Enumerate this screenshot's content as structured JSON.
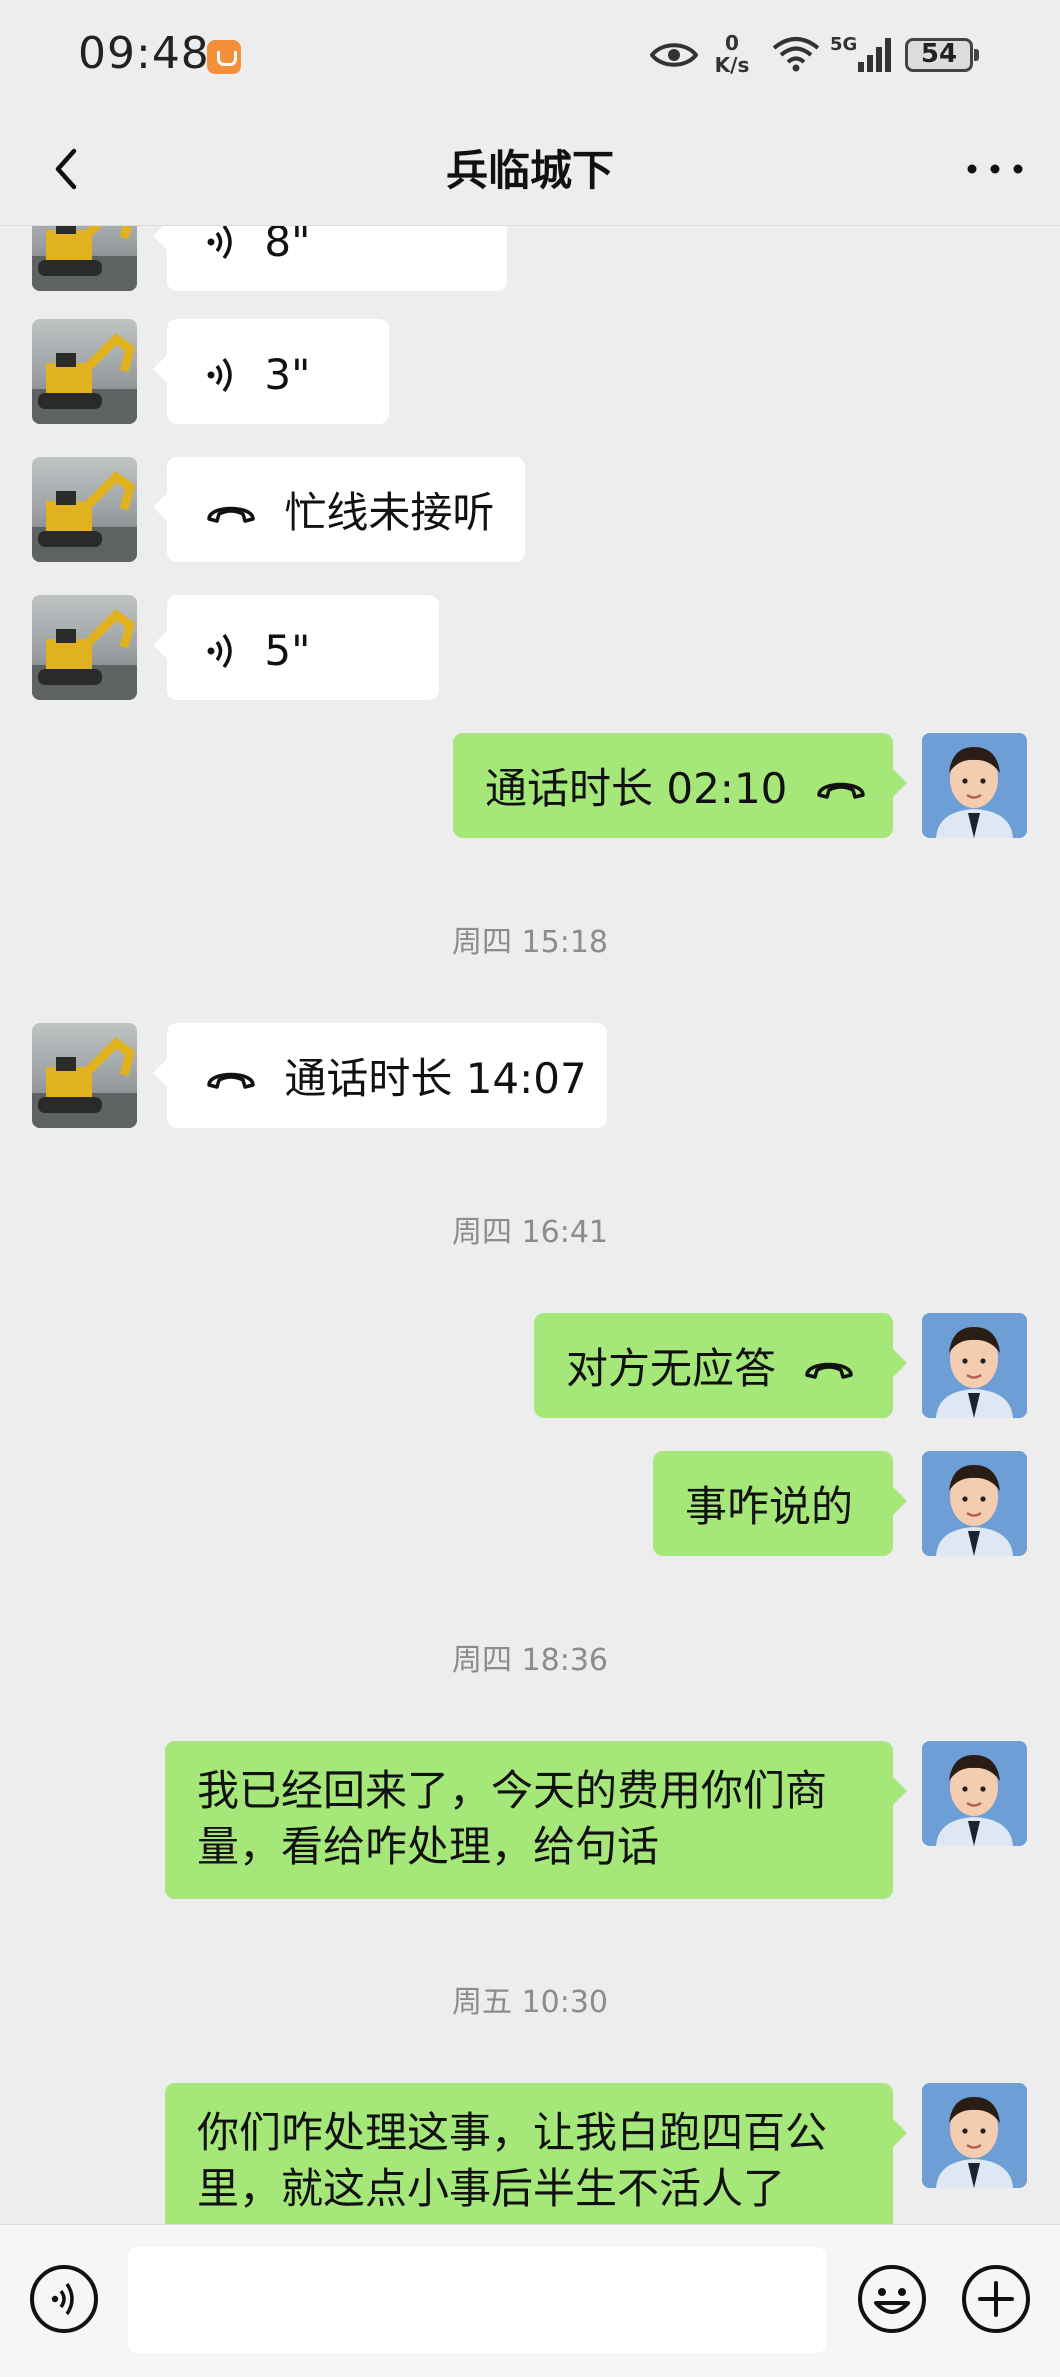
{
  "status_bar": {
    "time": "09:48",
    "net_speed_value": "0",
    "net_speed_unit": "K/s",
    "network_type": "5G",
    "battery": "54"
  },
  "header": {
    "title": "兵临城下"
  },
  "messages": [
    {
      "side": "in",
      "kind": "voice",
      "text": "8\""
    },
    {
      "side": "in",
      "kind": "voice",
      "text": "3\""
    },
    {
      "side": "in",
      "kind": "call",
      "text": "忙线未接听"
    },
    {
      "side": "in",
      "kind": "voice",
      "text": "5\""
    },
    {
      "side": "out",
      "kind": "call",
      "text": "通话时长 02:10"
    },
    {
      "kind": "timestamp",
      "text": "周四 15:18"
    },
    {
      "side": "in",
      "kind": "call",
      "text": "通话时长 14:07"
    },
    {
      "kind": "timestamp",
      "text": "周四 16:41"
    },
    {
      "side": "out",
      "kind": "call",
      "text": "对方无应答"
    },
    {
      "side": "out",
      "kind": "text",
      "text": "事咋说的"
    },
    {
      "kind": "timestamp",
      "text": "周四 18:36"
    },
    {
      "side": "out",
      "kind": "text",
      "text": "我已经回来了，今天的费用你们商量，看给咋处理，给句话"
    },
    {
      "kind": "timestamp",
      "text": "周五 10:30"
    },
    {
      "side": "out",
      "kind": "text",
      "text": "你们咋处理这事，让我白跑四百公里，就这点小事后半生不活人了"
    }
  ],
  "input_bar": {
    "text_value": ""
  },
  "colors": {
    "background": "#ededed",
    "incoming_bubble": "#ffffff",
    "outgoing_bubble": "#a5e879",
    "timestamp": "#8c8c8c"
  },
  "icons": {
    "back": "chevron-left-icon",
    "more": "more-dots-icon",
    "voice": "voice-wave-icon",
    "call": "phone-hangup-icon",
    "emoji": "emoji-icon",
    "plus": "plus-circle-icon"
  }
}
